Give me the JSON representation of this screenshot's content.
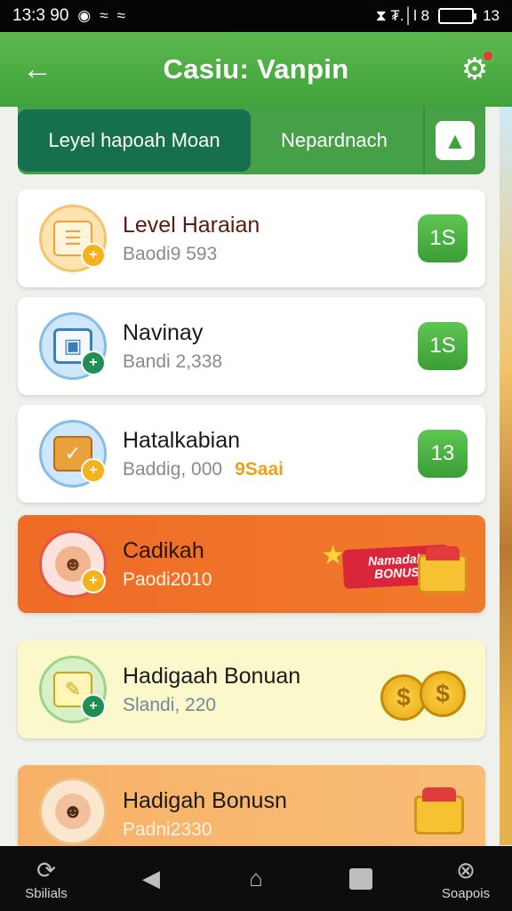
{
  "status_bar": {
    "time": "13:3 90",
    "left_icons": [
      "notification-icon",
      "wifi-icon",
      "wifi-icon"
    ],
    "right_text": "⧗ ₮.│l 8",
    "battery_label": "13"
  },
  "header": {
    "title": "Casiu: Vanpin",
    "back_icon": "back-arrow-icon",
    "settings_icon": "gear-icon"
  },
  "tabs": {
    "active": "Leyel hapoah Moan",
    "other": "Nepardnach",
    "icon": "graduation-cap-icon"
  },
  "items": [
    {
      "title": "Level Haraian",
      "subtitle": "Baodi9 593",
      "count": "1S",
      "icon": "document-icon",
      "accent": "#f5a623"
    },
    {
      "title": "Navinay",
      "subtitle": "Bandi 2,338",
      "count": "1S",
      "icon": "image-icon",
      "accent": "#4da3e0"
    },
    {
      "title": "Hatalkabian",
      "subtitle": "Baddig, 000",
      "tag": "9Saai",
      "count": "13",
      "icon": "book-icon",
      "accent": "#e3a033"
    },
    {
      "title": "Cadikah",
      "subtitle": "Paodi2010",
      "bonus_line1": "Namadah",
      "bonus_line2": "BONUS",
      "icon": "avatar-icon",
      "accent": "#e5534b"
    },
    {
      "title": "Hadigaah Bonuan",
      "subtitle": "Slandi, 220",
      "icon": "note-icon",
      "accent": "#7cc36b"
    },
    {
      "title": "Hadigah Bonusn",
      "subtitle": "Padni2330",
      "icon": "person-phone-icon",
      "accent": "#6fb1e8"
    }
  ],
  "nav": {
    "left_label": "Sbilials",
    "right_label": "Soapois",
    "left_icon": "refresh-icon",
    "right_icon": "close-circle-icon"
  },
  "colors": {
    "primary_green": "#3fa23a",
    "tab_dark": "#17704d",
    "orange_card": "#ef6b26",
    "yellow_card": "#fbf9cb",
    "peach_card": "#f7b168"
  }
}
